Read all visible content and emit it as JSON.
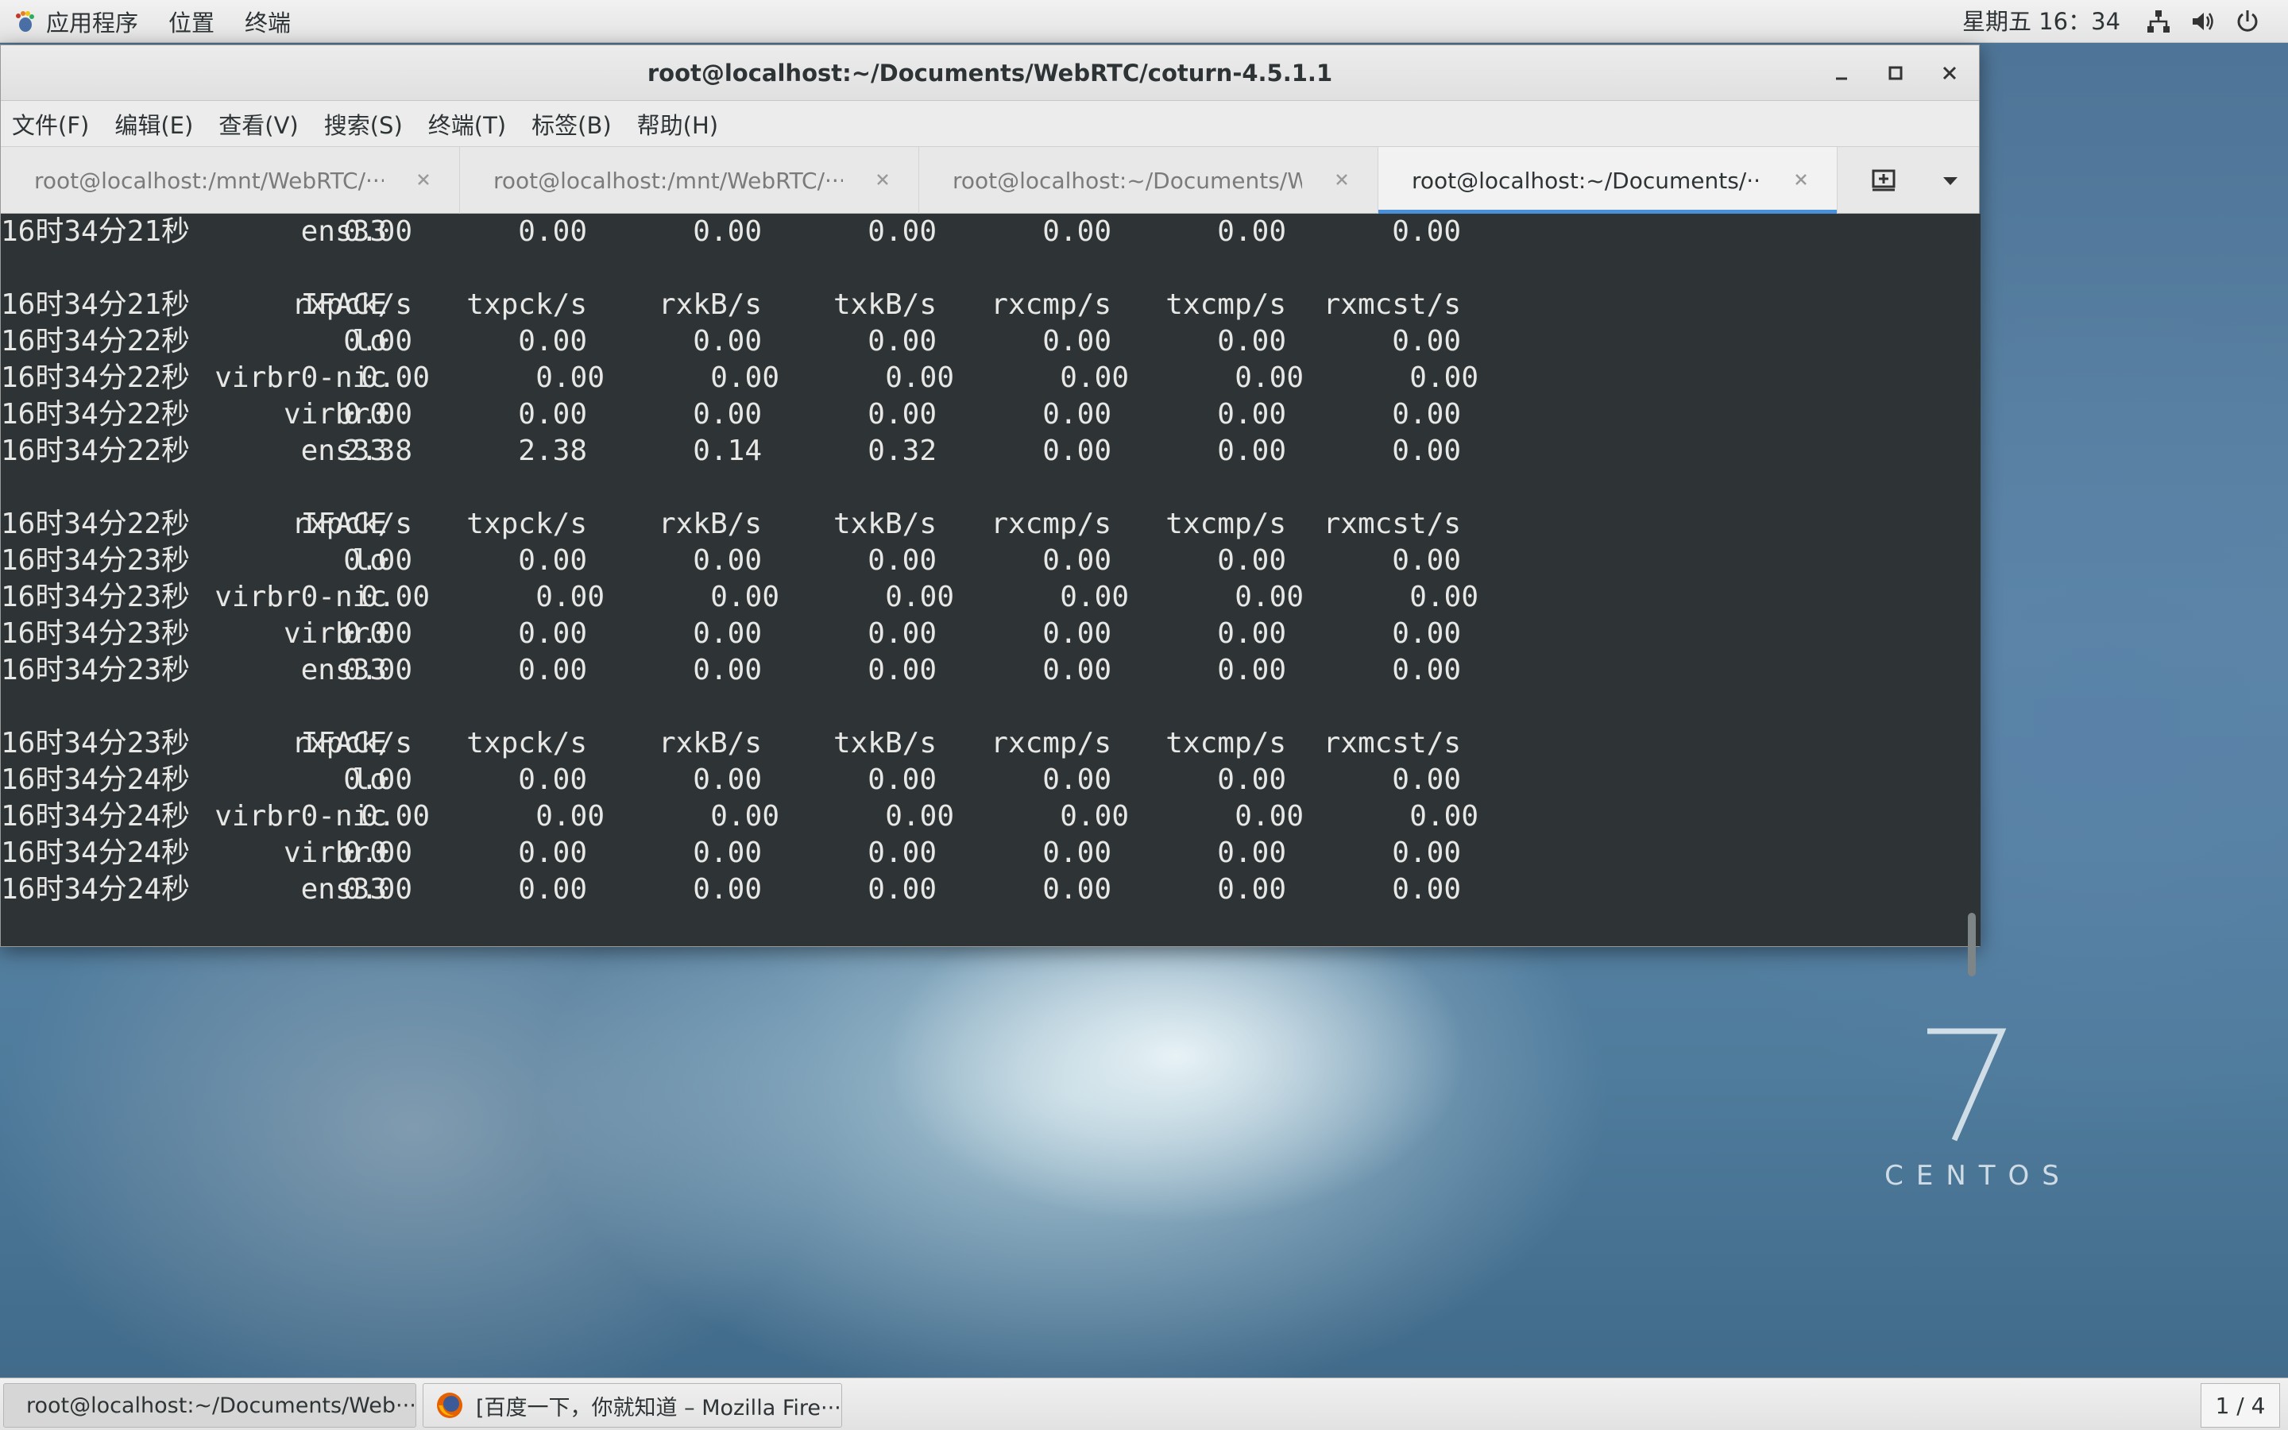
{
  "top_panel": {
    "menus": [
      "应用程序",
      "位置",
      "终端"
    ],
    "clock": "星期五 16：34",
    "icons": [
      "network-icon",
      "volume-icon",
      "power-icon"
    ]
  },
  "window": {
    "title": "root@localhost:~/Documents/WebRTC/coturn-4.5.1.1",
    "menu": [
      "文件(F)",
      "编辑(E)",
      "查看(V)",
      "搜索(S)",
      "终端(T)",
      "标签(B)",
      "帮助(H)"
    ],
    "tabs": [
      {
        "label": "root@localhost:/mnt/WebRTC/···",
        "active": false
      },
      {
        "label": "root@localhost:/mnt/WebRTC/···",
        "active": false
      },
      {
        "label": "root@localhost:~/Documents/W···",
        "active": false
      },
      {
        "label": "root@localhost:~/Documents/···",
        "active": true
      }
    ]
  },
  "terminal": {
    "lines": [
      {
        "time": "16时34分21秒",
        "iface": "ens33",
        "vals": [
          "0.00",
          "0.00",
          "0.00",
          "0.00",
          "0.00",
          "0.00",
          "0.00"
        ]
      },
      {
        "blank": true
      },
      {
        "time": "16时34分21秒",
        "iface": "IFACE",
        "vals": [
          "rxpck/s",
          "txpck/s",
          "rxkB/s",
          "txkB/s",
          "rxcmp/s",
          "txcmp/s",
          "rxmcst/s"
        ]
      },
      {
        "time": "16时34分22秒",
        "iface": "lo",
        "vals": [
          "0.00",
          "0.00",
          "0.00",
          "0.00",
          "0.00",
          "0.00",
          "0.00"
        ]
      },
      {
        "time": "16时34分22秒",
        "iface": "virbr0-nic",
        "vals": [
          "0.00",
          "0.00",
          "0.00",
          "0.00",
          "0.00",
          "0.00",
          "0.00"
        ],
        "shift": true
      },
      {
        "time": "16时34分22秒",
        "iface": "virbr0",
        "vals": [
          "0.00",
          "0.00",
          "0.00",
          "0.00",
          "0.00",
          "0.00",
          "0.00"
        ]
      },
      {
        "time": "16时34分22秒",
        "iface": "ens33",
        "vals": [
          "2.38",
          "2.38",
          "0.14",
          "0.32",
          "0.00",
          "0.00",
          "0.00"
        ]
      },
      {
        "blank": true
      },
      {
        "time": "16时34分22秒",
        "iface": "IFACE",
        "vals": [
          "rxpck/s",
          "txpck/s",
          "rxkB/s",
          "txkB/s",
          "rxcmp/s",
          "txcmp/s",
          "rxmcst/s"
        ]
      },
      {
        "time": "16时34分23秒",
        "iface": "lo",
        "vals": [
          "0.00",
          "0.00",
          "0.00",
          "0.00",
          "0.00",
          "0.00",
          "0.00"
        ]
      },
      {
        "time": "16时34分23秒",
        "iface": "virbr0-nic",
        "vals": [
          "0.00",
          "0.00",
          "0.00",
          "0.00",
          "0.00",
          "0.00",
          "0.00"
        ],
        "shift": true
      },
      {
        "time": "16时34分23秒",
        "iface": "virbr0",
        "vals": [
          "0.00",
          "0.00",
          "0.00",
          "0.00",
          "0.00",
          "0.00",
          "0.00"
        ]
      },
      {
        "time": "16时34分23秒",
        "iface": "ens33",
        "vals": [
          "0.00",
          "0.00",
          "0.00",
          "0.00",
          "0.00",
          "0.00",
          "0.00"
        ]
      },
      {
        "blank": true
      },
      {
        "time": "16时34分23秒",
        "iface": "IFACE",
        "vals": [
          "rxpck/s",
          "txpck/s",
          "rxkB/s",
          "txkB/s",
          "rxcmp/s",
          "txcmp/s",
          "rxmcst/s"
        ]
      },
      {
        "time": "16时34分24秒",
        "iface": "lo",
        "vals": [
          "0.00",
          "0.00",
          "0.00",
          "0.00",
          "0.00",
          "0.00",
          "0.00"
        ]
      },
      {
        "time": "16时34分24秒",
        "iface": "virbr0-nic",
        "vals": [
          "0.00",
          "0.00",
          "0.00",
          "0.00",
          "0.00",
          "0.00",
          "0.00"
        ],
        "shift": true
      },
      {
        "time": "16时34分24秒",
        "iface": "virbr0",
        "vals": [
          "0.00",
          "0.00",
          "0.00",
          "0.00",
          "0.00",
          "0.00",
          "0.00"
        ]
      },
      {
        "time": "16时34分24秒",
        "iface": "ens33",
        "vals": [
          "0.00",
          "0.00",
          "0.00",
          "0.00",
          "0.00",
          "0.00",
          "0.00"
        ]
      }
    ]
  },
  "desktop": {
    "logo_number": "7",
    "logo_text": "CENTOS"
  },
  "taskbar": {
    "items": [
      {
        "label": "root@localhost:~/Documents/Web···",
        "icon": "terminal-icon",
        "active": true
      },
      {
        "label": "[百度一下，你就知道 – Mozilla Fire···",
        "icon": "firefox-icon",
        "active": false
      }
    ],
    "workspace": "1 / 4"
  }
}
